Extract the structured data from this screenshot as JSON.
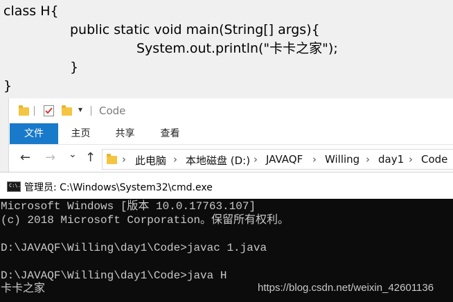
{
  "code": {
    "lines": [
      "class H{",
      "public static void main(String[] args){",
      "System.out.println(\"卡卡之家\");",
      "}",
      "}"
    ]
  },
  "explorer": {
    "title": "Code",
    "ribbon_tabs": [
      "文件",
      "主页",
      "共享",
      "查看"
    ],
    "nav": {
      "back": "←",
      "forward": "→",
      "recent": "⌄",
      "up": "↑"
    },
    "breadcrumb": [
      "此电脑",
      "本地磁盘 (D:)",
      "JAVAQF",
      "Willing",
      "day1",
      "Code"
    ]
  },
  "cmd": {
    "icon_label": "C:\\.",
    "title": "管理员: C:\\Windows\\System32\\cmd.exe",
    "lines": [
      "Microsoft Windows [版本 10.0.17763.107]",
      "(c) 2018 Microsoft Corporation。保留所有权利。",
      "",
      "D:\\JAVAQF\\Willing\\day1\\Code>javac 1.java",
      "",
      "D:\\JAVAQF\\Willing\\day1\\Code>java H",
      "卡卡之家"
    ],
    "watermark": "https://blog.csdn.net/weixin_42601136"
  }
}
